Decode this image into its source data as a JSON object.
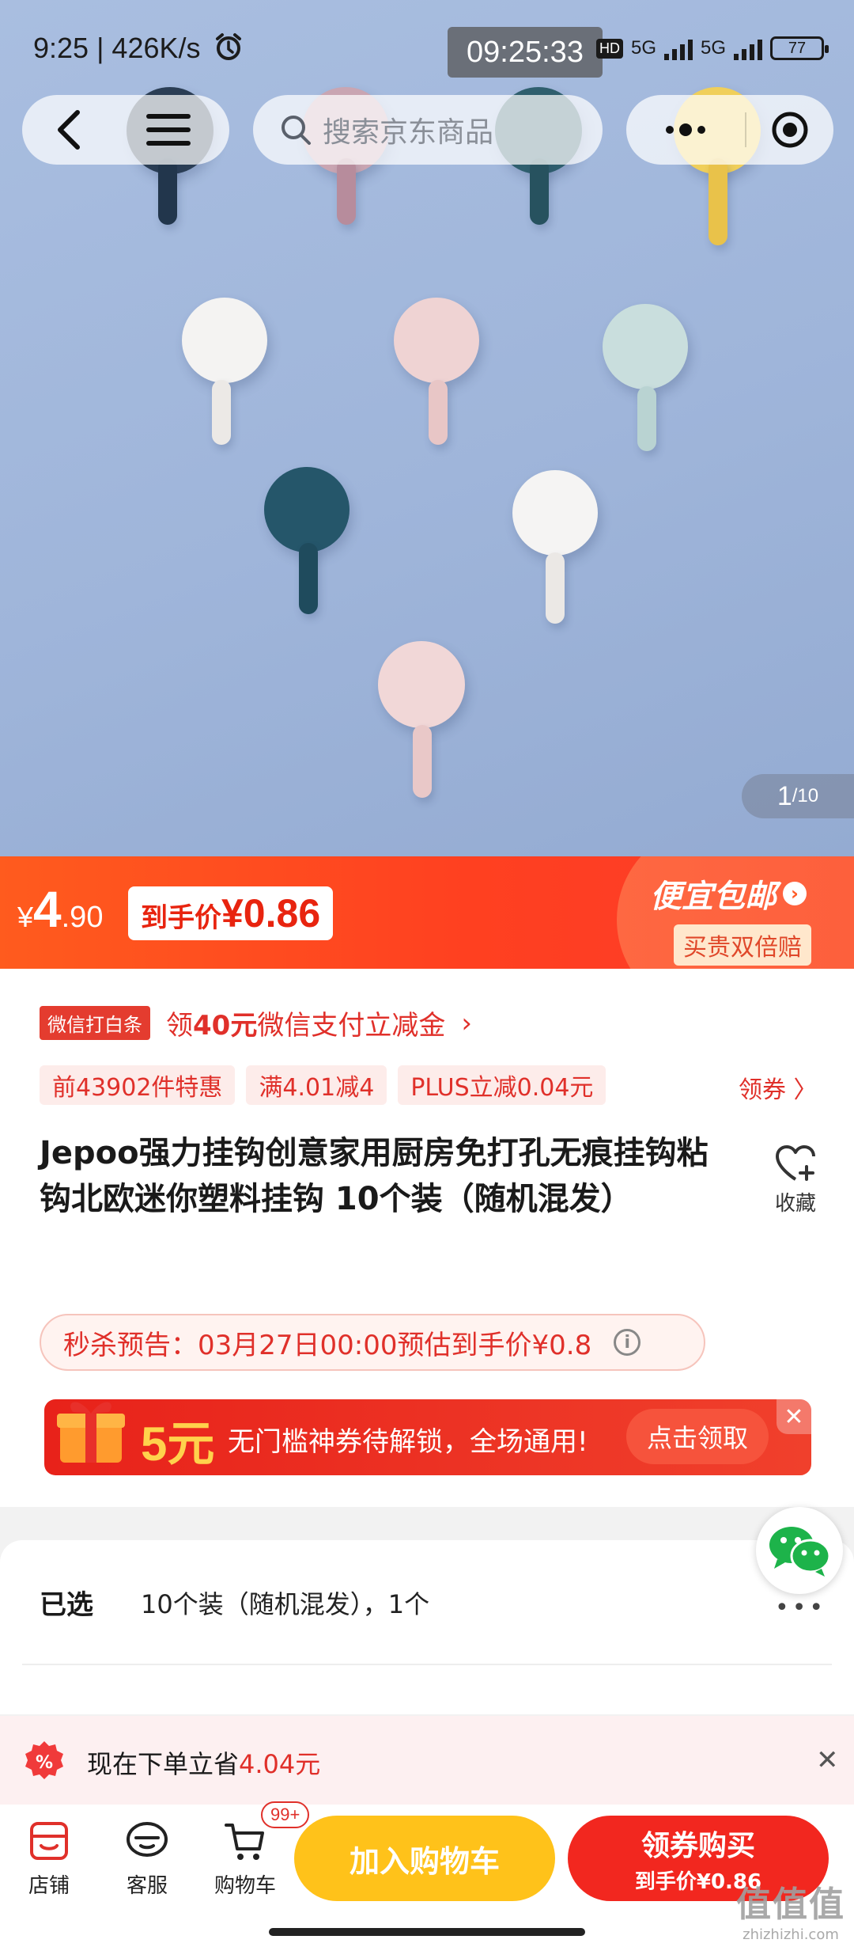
{
  "status_bar": {
    "left_text": "9:25 | 426K/s",
    "center_time": "09:25:33",
    "network": "5G",
    "battery": "77"
  },
  "nav": {
    "search_placeholder": "搜索京东商品"
  },
  "gallery": {
    "index": "1",
    "total": "/10"
  },
  "price": {
    "currency": "¥",
    "int": "4",
    "dec": ".90",
    "final_label": "到手价",
    "final_value": "¥0.86",
    "promo_title": "便宜包邮",
    "promo_sub": "买贵双倍赔"
  },
  "wechat_promo": {
    "badge": "微信打白条",
    "text_before": "领",
    "amount": "40元",
    "text_after": "微信支付立减金"
  },
  "tags": [
    "前43902件特惠",
    "满4.01减4",
    "PLUS立减0.04元"
  ],
  "coupon_link": "领券 〉",
  "product": {
    "title": "Jepoo强力挂钩创意家用厨房免打孔无痕挂钩粘钩北欧迷你塑料挂钩 10个装（随机混发）",
    "favorite_label": "收藏"
  },
  "flash_sale": {
    "text": "秒杀预告：03月27日00:00预估到手价¥0.8"
  },
  "coupon_banner": {
    "amount": "5元",
    "desc": "无门槛神券待解锁，全场通用!",
    "button": "点击领取"
  },
  "selection": {
    "label": "已选",
    "value": "10个装（随机混发），1个"
  },
  "save_strip": {
    "text": "现在下单立省",
    "amount": "4.04元"
  },
  "bottom_bar": {
    "shop": "店铺",
    "service": "客服",
    "cart": "购物车",
    "cart_badge": "99+",
    "add_to_cart": "加入购物车",
    "buy_main": "领券购买",
    "buy_sub": "到手价¥0.86"
  },
  "watermark": {
    "big": "值值值",
    "small": "zhizhizhi.com"
  },
  "colors": {
    "accent_red": "#e0302a",
    "price_orange": "#ff4a20",
    "cart_yellow": "#ffc21a"
  }
}
